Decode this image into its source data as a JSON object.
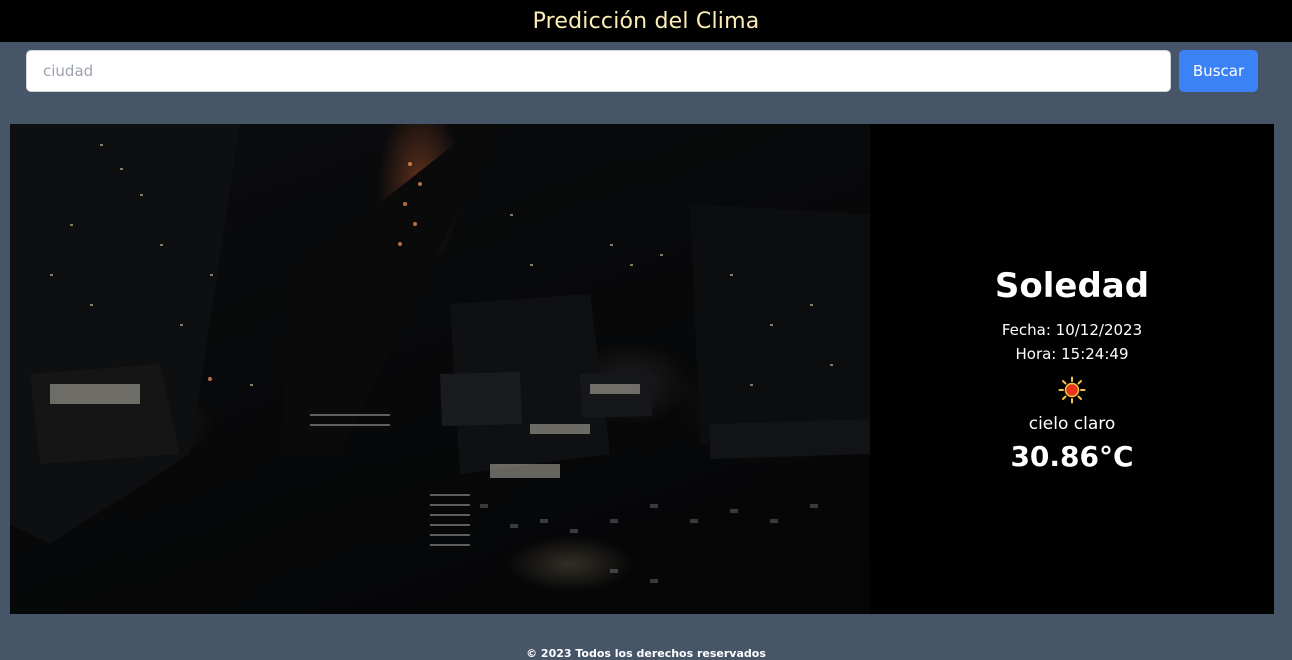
{
  "header": {
    "title": "Predicción del Clima"
  },
  "search": {
    "placeholder": "ciudad",
    "value": "",
    "button_label": "Buscar"
  },
  "weather": {
    "city": "Soledad",
    "date_text": "Fecha: 10/12/2023",
    "time_text": "Hora: 15:24:49",
    "icon": "sun-icon",
    "description": "cielo claro",
    "temperature": "30.86°C"
  },
  "footer": {
    "text": "© 2023 Todos los derechos reservados"
  },
  "colors": {
    "page_bg": "#475569",
    "header_bg": "#000000",
    "title_color": "#fdeeb5",
    "button_bg": "#3b82f6",
    "panel_bg": "#000000"
  }
}
